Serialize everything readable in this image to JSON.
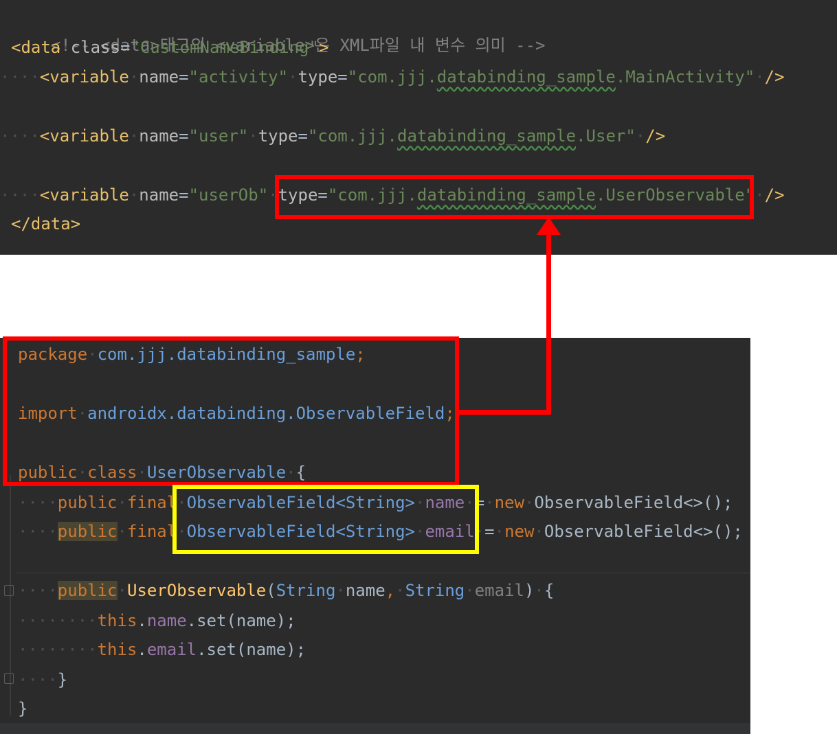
{
  "xml": {
    "comment": "<!-- <data>태그의 <variable>은 XML파일 내 변수 의미 -->",
    "data_open_tag": "<data",
    "data_class_attr": "class",
    "data_class_value": "\"CustomNameBinding\"",
    "data_open_close": ">",
    "variables": [
      {
        "name_value": "\"activity\"",
        "type_prefix": "\"com.jjj.",
        "type_pkg": "databinding_sample",
        "type_suffix": ".MainActivity\""
      },
      {
        "name_value": "\"user\"",
        "type_prefix": "\"com.jjj.",
        "type_pkg": "databinding_sample",
        "type_suffix": ".User\""
      },
      {
        "name_value": "\"userOb\"",
        "type_prefix": "\"com.jjj.",
        "type_pkg": "databinding_sample",
        "type_suffix": ".UserObservable\""
      }
    ],
    "variable_tag": "<variable",
    "name_attr": "name",
    "type_attr": "type",
    "self_close": "/>",
    "data_close_tag": "</data>"
  },
  "java": {
    "package_kw": "package",
    "package_name": "com.jjj.databinding_sample",
    "import_kw": "import",
    "import_name": "androidx.databinding.ObservableField",
    "public_kw": "public",
    "class_kw": "class",
    "final_kw": "final",
    "new_kw": "new",
    "this_kw": "this",
    "class_name": "UserObservable",
    "field_type": "ObservableField<String>",
    "field_name": "name",
    "field_email": "email",
    "ctor_init": "ObservableField<>();",
    "ctor_name": "UserObservable",
    "string_type": "String",
    "set_call": ".set(name);",
    "open_brace": "{",
    "close_brace": "}"
  },
  "annotations": {
    "red_color": "#ff0000",
    "yellow_color": "#ffff00"
  }
}
